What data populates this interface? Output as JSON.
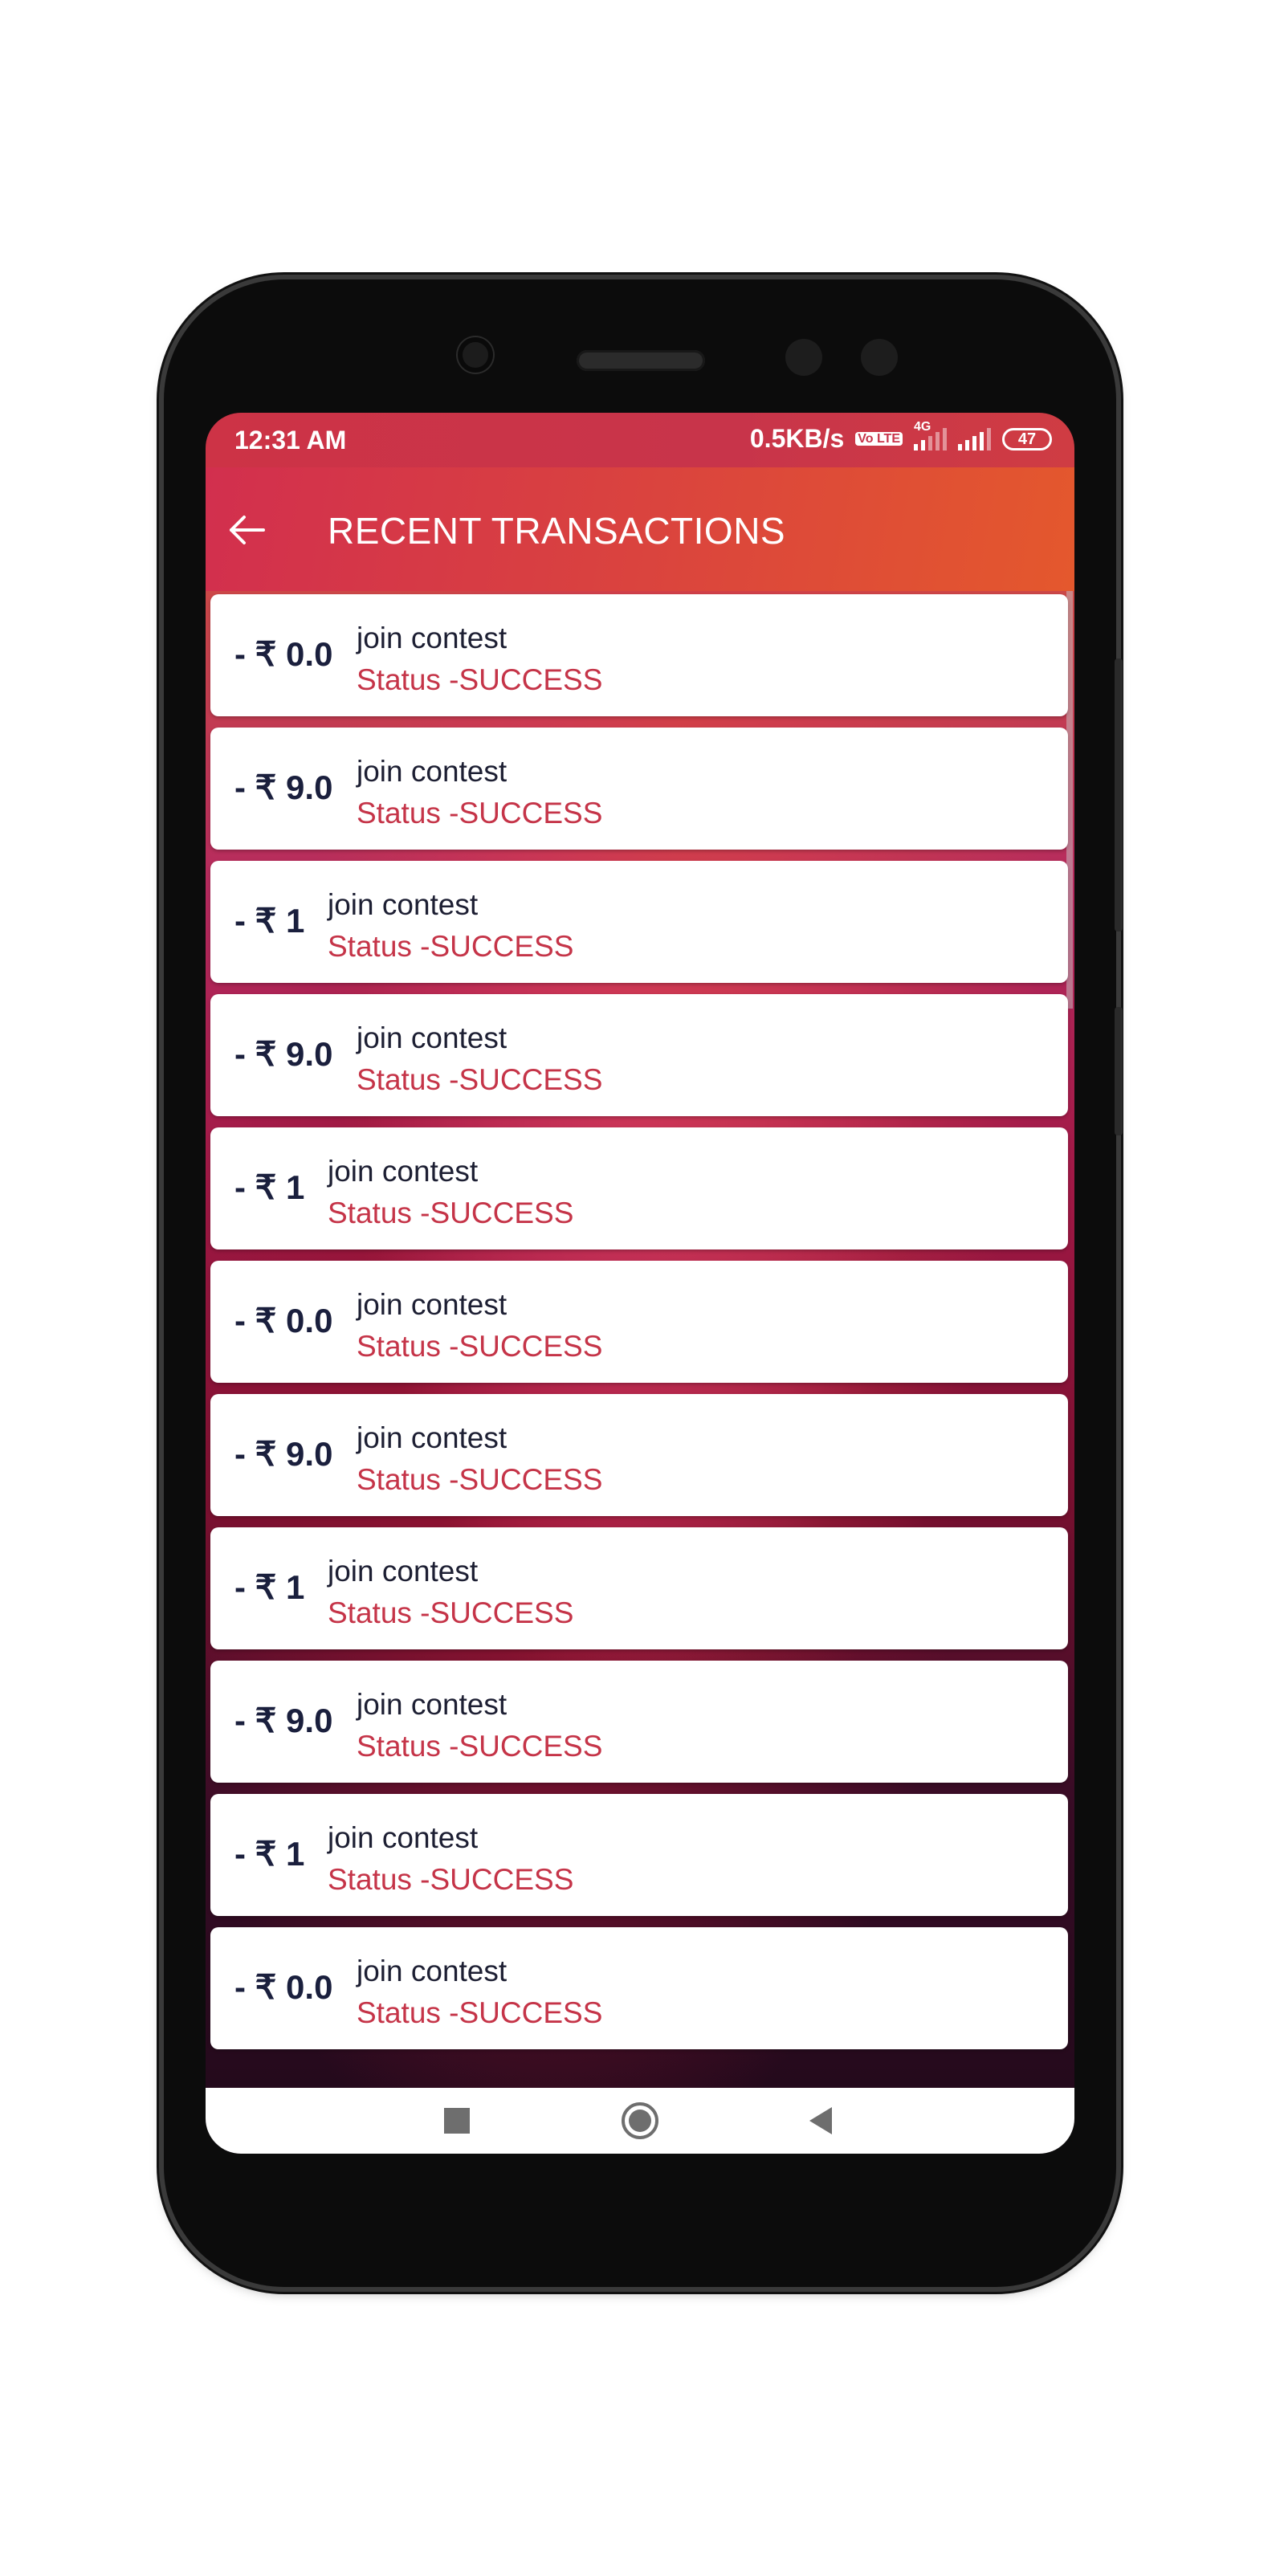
{
  "status_bar": {
    "time": "12:31 AM",
    "network_speed": "0.5KB/s",
    "volte": "Vo LTE",
    "network_type": "4G",
    "battery": "47"
  },
  "app_bar": {
    "back_icon": "arrow-left-icon",
    "title": "RECENT TRANSACTIONS"
  },
  "transactions": [
    {
      "amount": "- ₹ 0.0",
      "description": "join contest",
      "status": "Status -SUCCESS"
    },
    {
      "amount": "- ₹ 9.0",
      "description": "join contest",
      "status": "Status -SUCCESS"
    },
    {
      "amount": "- ₹ 1",
      "description": "join contest",
      "status": "Status -SUCCESS"
    },
    {
      "amount": "- ₹ 9.0",
      "description": "join contest",
      "status": "Status -SUCCESS"
    },
    {
      "amount": "- ₹ 1",
      "description": "join contest",
      "status": "Status -SUCCESS"
    },
    {
      "amount": "- ₹ 0.0",
      "description": "join contest",
      "status": "Status -SUCCESS"
    },
    {
      "amount": "- ₹ 9.0",
      "description": "join contest",
      "status": "Status -SUCCESS"
    },
    {
      "amount": "- ₹ 1",
      "description": "join contest",
      "status": "Status -SUCCESS"
    },
    {
      "amount": "- ₹ 9.0",
      "description": "join contest",
      "status": "Status -SUCCESS"
    },
    {
      "amount": "- ₹ 1",
      "description": "join contest",
      "status": "Status -SUCCESS"
    },
    {
      "amount": "- ₹ 0.0",
      "description": "join contest",
      "status": "Status -SUCCESS"
    }
  ],
  "nav_bar": {
    "recents_icon": "square-recents-icon",
    "home_icon": "circle-home-icon",
    "back_icon": "triangle-back-icon"
  },
  "colors": {
    "accent": "#d94140",
    "status_text": "#c53448",
    "amount_text": "#1a1f3d"
  }
}
